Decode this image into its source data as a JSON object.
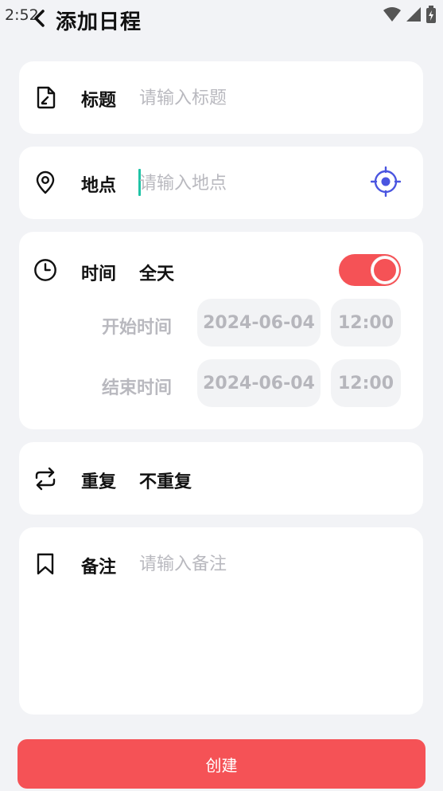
{
  "status_bar": {
    "time": "2:52"
  },
  "header": {
    "title": "添加日程"
  },
  "title_row": {
    "label": "标题",
    "placeholder": "请输入标题"
  },
  "location_row": {
    "label": "地点",
    "placeholder": "请输入地点"
  },
  "time_row": {
    "label": "时间",
    "value": "全天",
    "all_day_on": true,
    "start_label": "开始时间",
    "start_date": "2024-06-04",
    "start_time": "12:00",
    "end_label": "结束时间",
    "end_date": "2024-06-04",
    "end_time": "12:00"
  },
  "repeat_row": {
    "label": "重复",
    "value": "不重复"
  },
  "note_row": {
    "label": "备注",
    "placeholder": "请输入备注"
  },
  "submit": {
    "label": "创建"
  },
  "colors": {
    "accent": "#f55256",
    "locate_icon": "#4a55e0",
    "caret": "#1fc3a6",
    "background": "#f2f3f6"
  },
  "icons": {
    "back": "chevron-left-icon",
    "title": "edit-document-icon",
    "location": "map-pin-icon",
    "locate": "gps-target-icon",
    "time": "clock-icon",
    "repeat": "repeat-icon",
    "note": "bookmark-icon"
  }
}
